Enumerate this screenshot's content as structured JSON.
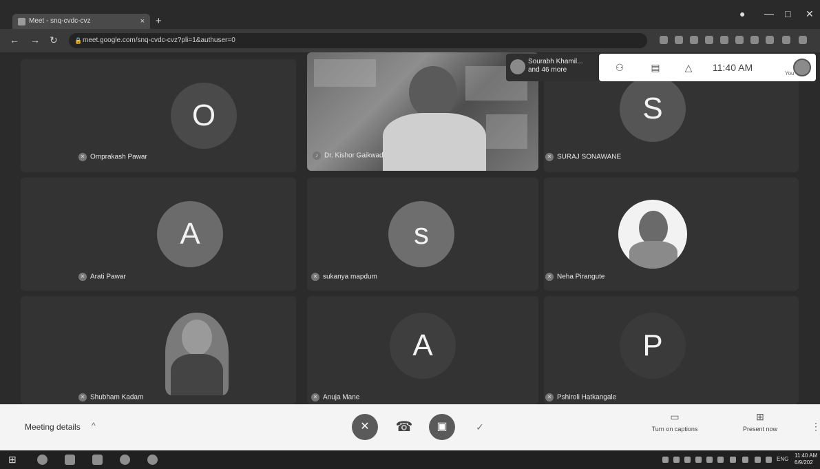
{
  "browser": {
    "tab_title": "Meet - snq-cvdc-cvz",
    "tab_close": "×",
    "new_tab": "+",
    "url": "meet.google.com/snq-cvdc-cvz?pli=1&authuser=0",
    "window_controls": {
      "minimize": "—",
      "maximize": "□",
      "close": "✕"
    }
  },
  "top_bar": {
    "more_participants_name": "Sourabh Khamil...",
    "more_participants_count": "and 46 more",
    "time": "11:40 AM",
    "you_label": "You",
    "icons": [
      "people-icon",
      "chat-icon",
      "activities-icon"
    ]
  },
  "participants": [
    {
      "name": "Omprakash Pawar",
      "initial": "O",
      "kind": "initial",
      "color": "#4a4a4a"
    },
    {
      "name": "Dr. Kishor Gaikwad",
      "initial": "",
      "kind": "video",
      "color": "#7a7a7a"
    },
    {
      "name": "SURAJ SONAWANE",
      "initial": "S",
      "kind": "initial",
      "color": "#555555"
    },
    {
      "name": "Arati Pawar",
      "initial": "A",
      "kind": "initial",
      "color": "#6b6b6b"
    },
    {
      "name": "sukanya mapdum",
      "initial": "s",
      "kind": "initial",
      "color": "#6e6e6e"
    },
    {
      "name": "Neha Pirangute",
      "initial": "",
      "kind": "photo",
      "color": "#f2f2f2"
    },
    {
      "name": "Shubham Kadam",
      "initial": "",
      "kind": "photo",
      "color": "#7a7a7a"
    },
    {
      "name": "Anuja Mane",
      "initial": "A",
      "kind": "initial",
      "color": "#3e3e3e"
    },
    {
      "name": "Pshiroli Hatkangale",
      "initial": "P",
      "kind": "initial",
      "color": "#3a3a3a"
    }
  ],
  "bottom_bar": {
    "meeting_details": "Meeting details",
    "chevron": "^",
    "captions": "Turn on captions",
    "present": "Present now",
    "more": "⋮"
  },
  "taskbar": {
    "lang": "ENG",
    "time": "11:40 AM",
    "date": "6/9/202"
  }
}
